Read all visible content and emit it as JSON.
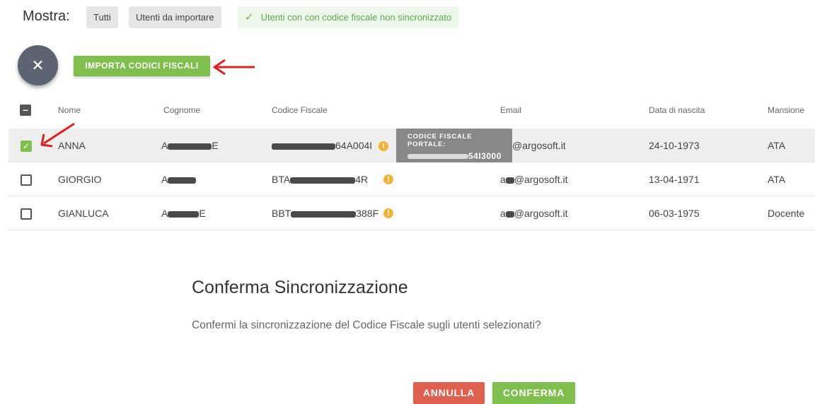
{
  "filter": {
    "label": "Mostra:",
    "options": [
      "Tutti",
      "Utenti da importare",
      "Utenti con con codice fiscale non sincronizzato"
    ],
    "check_icon": "check-icon"
  },
  "fab": {
    "close_symbol": "✕",
    "icon": "close-icon"
  },
  "import_button": "IMPORTA CODICI FISCALI",
  "table": {
    "headers": [
      "Nome",
      "Cognome",
      "Codice Fiscale",
      "Email",
      "Data di nascita",
      "Mansione"
    ],
    "rows": [
      {
        "nome": "ANNA",
        "cognome_start": "A",
        "cognome_end": "E",
        "cf_start": "",
        "cf_end": "64A004I",
        "email_start": "",
        "email_end": "@argosoft.it",
        "data": "24-10-1973",
        "mansione": "ATA",
        "selected": true
      },
      {
        "nome": "GIORGIO",
        "cognome_start": "A",
        "cognome_end": "",
        "cf_start": "BTA",
        "cf_end": "4R",
        "email_start": "a",
        "email_end": "@argosoft.it",
        "data": "13-04-1971",
        "mansione": "ATA",
        "selected": false
      },
      {
        "nome": "GIANLUCA",
        "cognome_start": "A",
        "cognome_end": "E",
        "cf_start": "BBT",
        "cf_end": "388F",
        "email_start": "a",
        "email_end": "@argosoft.it",
        "data": "06-03-1975",
        "mansione": "Docente",
        "selected": false
      }
    ]
  },
  "tooltip": {
    "title": "CODICE FISCALE PORTALE:",
    "value_end": "54I3000"
  },
  "dialog": {
    "title": "Conferma Sincronizzazione",
    "body": "Confermi la sincronizzazione del Codice Fiscale sugli utenti selezionati?",
    "cancel": "ANNULLA",
    "confirm": "CONFERMA"
  },
  "colors": {
    "accent_green": "#7fbf4d",
    "danger_red": "#e06050",
    "annotation_red": "#e02020"
  }
}
